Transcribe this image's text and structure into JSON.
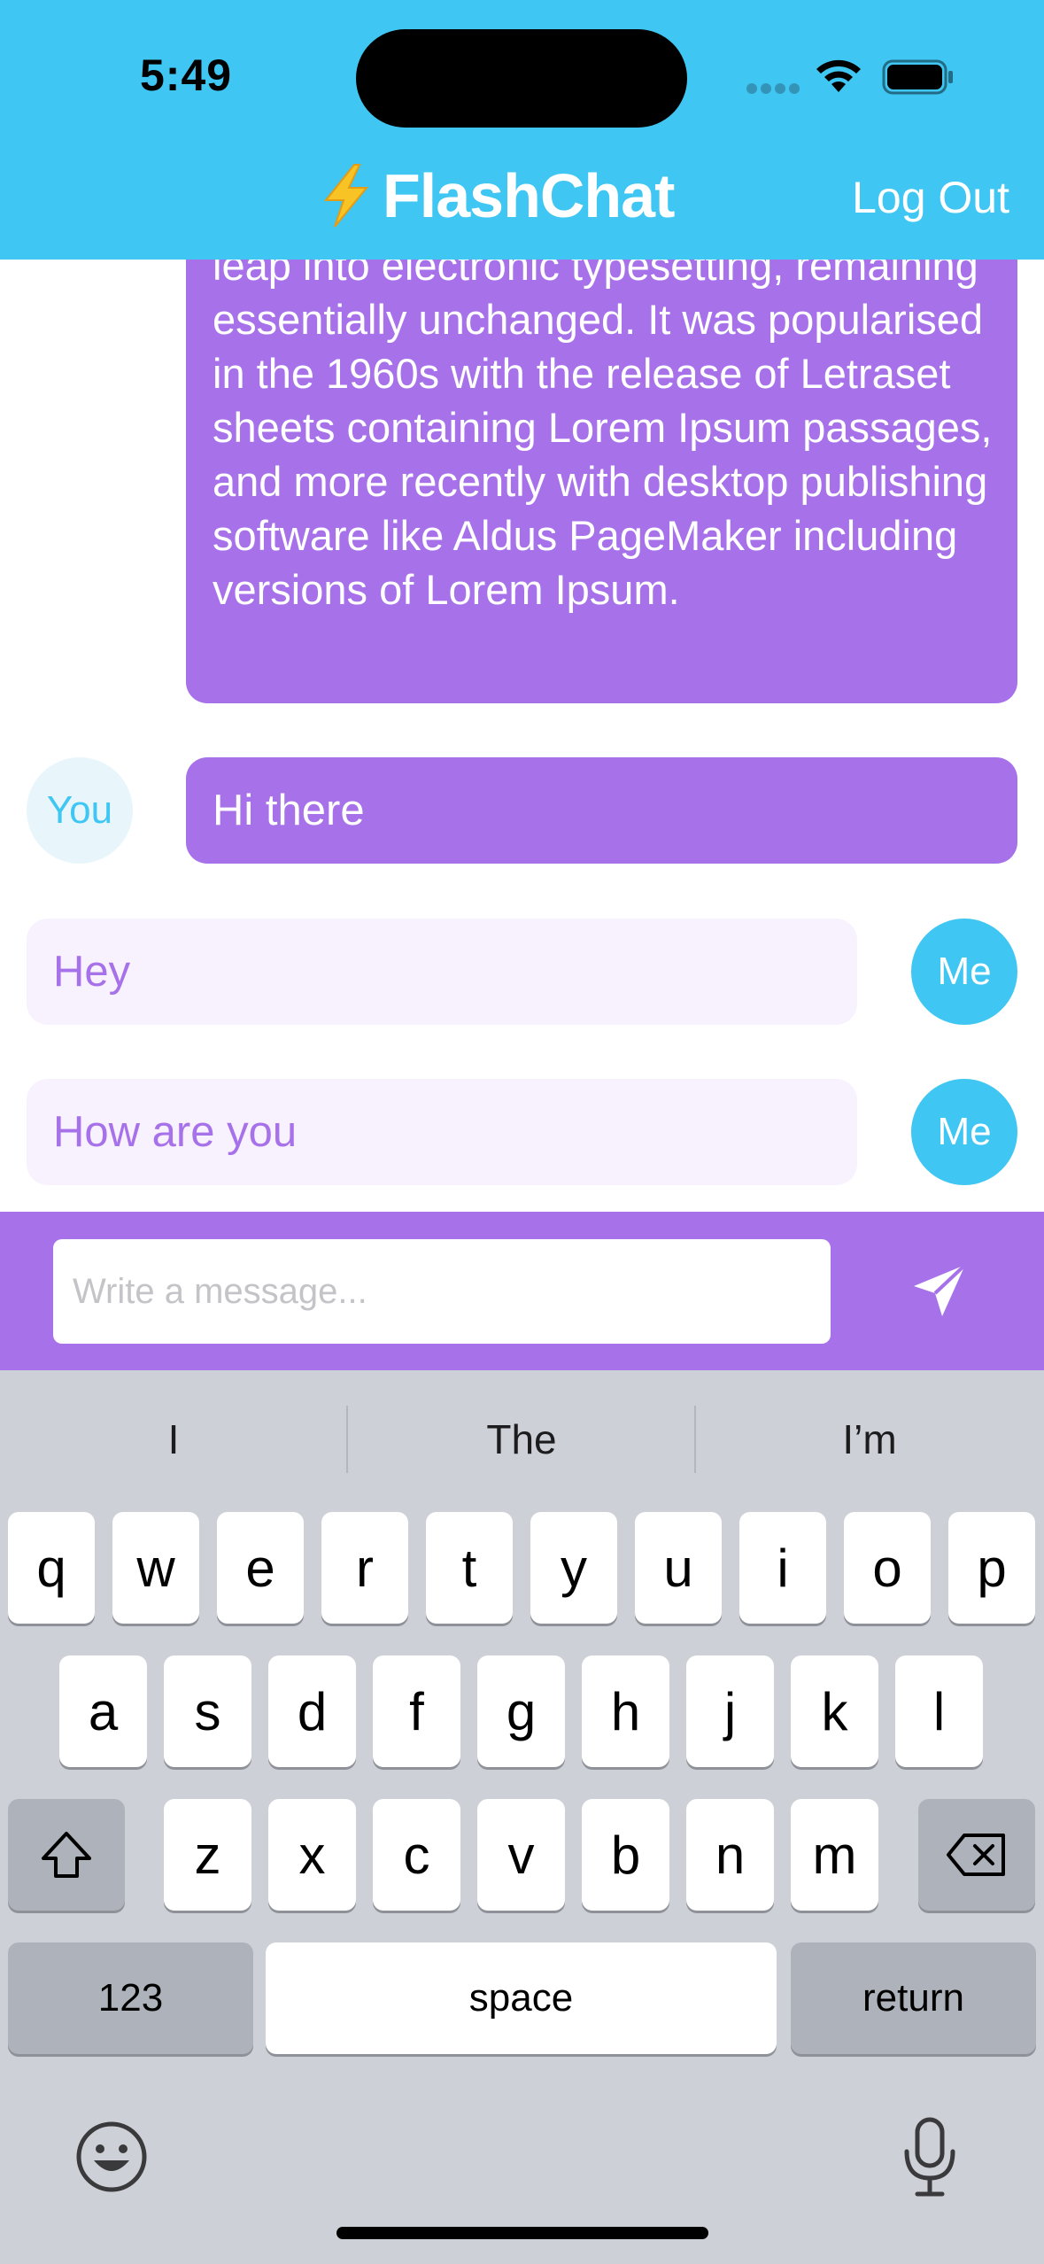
{
  "status_bar": {
    "time": "5:49"
  },
  "header": {
    "title": "FlashChat",
    "logout_label": "Log Out"
  },
  "messages": [
    {
      "sender": "You",
      "text": "leap into electronic typesetting, remaining essentially unchanged. It was popularised in the 1960s with the release of Letraset sheets containing Lorem Ipsum passages, and more recently with desktop publishing software like Aldus PageMaker including versions of Lorem Ipsum."
    },
    {
      "sender": "You",
      "avatar_label": "You",
      "text": "Hi there"
    },
    {
      "sender": "Me",
      "avatar_label": "Me",
      "text": "Hey"
    },
    {
      "sender": "Me",
      "avatar_label": "Me",
      "text": "How are you"
    }
  ],
  "composer": {
    "placeholder": "Write a message...",
    "value": "",
    "send_icon": "paper-plane-icon"
  },
  "keyboard": {
    "suggestions": [
      "I",
      "The",
      "I’m"
    ],
    "row1": [
      "q",
      "w",
      "e",
      "r",
      "t",
      "y",
      "u",
      "i",
      "o",
      "p"
    ],
    "row2": [
      "a",
      "s",
      "d",
      "f",
      "g",
      "h",
      "j",
      "k",
      "l"
    ],
    "row3": [
      "z",
      "x",
      "c",
      "v",
      "b",
      "n",
      "m"
    ],
    "numbers_label": "123",
    "space_label": "space",
    "return_label": "return"
  },
  "colors": {
    "header": "#3fc6f2",
    "accent_purple": "#a771ea",
    "me_bubble": "#f7f2fd",
    "you_avatar_bg": "#e8f6fb"
  }
}
